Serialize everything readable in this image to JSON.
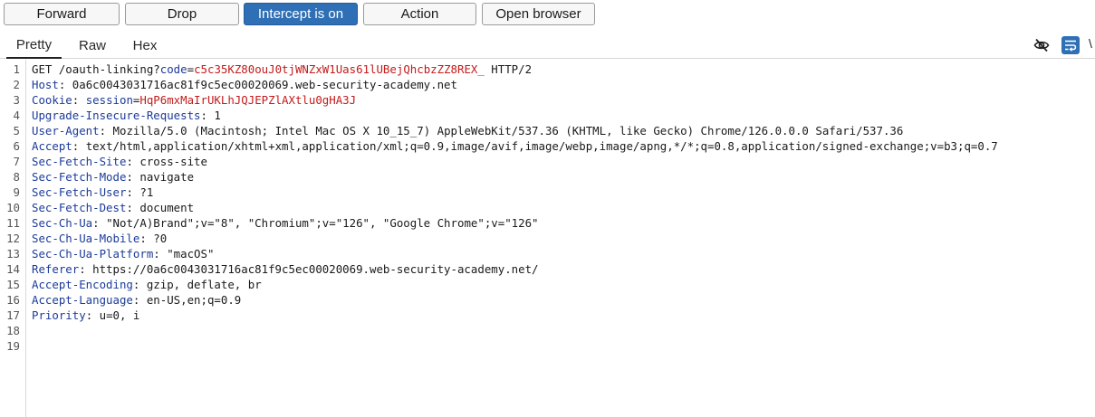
{
  "toolbar": {
    "forward": "Forward",
    "drop": "Drop",
    "intercept": "Intercept is on",
    "action": "Action",
    "open_browser": "Open browser"
  },
  "tabs": {
    "pretty": "Pretty",
    "raw": "Raw",
    "hex": "Hex"
  },
  "icons": {
    "hide": "eye-slash-icon",
    "wrap": "wrap-lines-icon"
  },
  "colors": {
    "accent": "#2f6fb5",
    "header_name": "#1b3b9a",
    "param_value": "#c41a1a"
  },
  "request": {
    "line1": {
      "method_path": "GET /oauth-linking?",
      "param": "code",
      "eq": "=",
      "value": "c5c35KZ80ouJ0tjWNZxW1Uas61lUBejQhcbzZZ8REX_",
      "version": " HTTP/2"
    },
    "host": {
      "name": "Host",
      "value": " 0a6c0043031716ac81f9c5ec00020069.web-security-academy.net"
    },
    "cookie": {
      "name": "Cookie",
      "sep": ": ",
      "cname": "session",
      "eq": "=",
      "cvalue": "HqP6mxMaIrUKLhJQJEPZlAXtlu0gHA3J"
    },
    "uir": {
      "name": "Upgrade-Insecure-Requests",
      "value": " 1"
    },
    "ua": {
      "name": "User-Agent",
      "value": " Mozilla/5.0 (Macintosh; Intel Mac OS X 10_15_7) AppleWebKit/537.36 (KHTML, like Gecko) Chrome/126.0.0.0 Safari/537.36"
    },
    "accept": {
      "name": "Accept",
      "value": " text/html,application/xhtml+xml,application/xml;q=0.9,image/avif,image/webp,image/apng,*/*;q=0.8,application/signed-exchange;v=b3;q=0.7"
    },
    "sfsite": {
      "name": "Sec-Fetch-Site",
      "value": " cross-site"
    },
    "sfmode": {
      "name": "Sec-Fetch-Mode",
      "value": " navigate"
    },
    "sfuser": {
      "name": "Sec-Fetch-User",
      "value": " ?1"
    },
    "sfdest": {
      "name": "Sec-Fetch-Dest",
      "value": " document"
    },
    "chua": {
      "name": "Sec-Ch-Ua",
      "value": " \"Not/A)Brand\";v=\"8\", \"Chromium\";v=\"126\", \"Google Chrome\";v=\"126\""
    },
    "chmobile": {
      "name": "Sec-Ch-Ua-Mobile",
      "value": " ?0"
    },
    "chplatform": {
      "name": "Sec-Ch-Ua-Platform",
      "value": " \"macOS\""
    },
    "referer": {
      "name": "Referer",
      "value": " https://0a6c0043031716ac81f9c5ec00020069.web-security-academy.net/"
    },
    "encoding": {
      "name": "Accept-Encoding",
      "value": " gzip, deflate, br"
    },
    "language": {
      "name": "Accept-Language",
      "value": " en-US,en;q=0.9"
    },
    "priority": {
      "name": "Priority",
      "value": " u=0, i"
    }
  },
  "line_numbers": [
    "1",
    "2",
    "3",
    "4",
    "5",
    "6",
    "7",
    "8",
    "9",
    "10",
    "11",
    "12",
    "13",
    "14",
    "15",
    "16",
    "17",
    "18",
    "19"
  ]
}
